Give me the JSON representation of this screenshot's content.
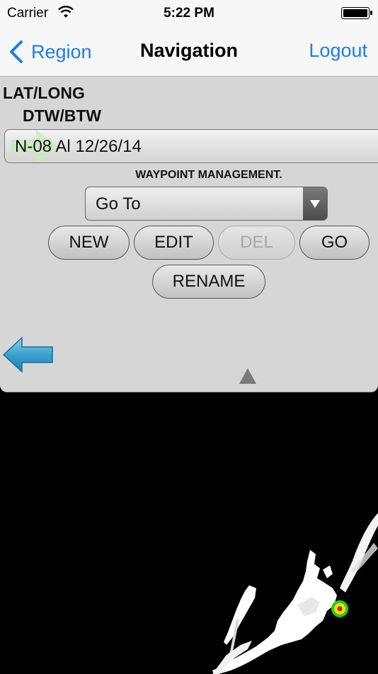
{
  "status_bar": {
    "carrier": "Carrier",
    "time": "5:22 PM",
    "icons": [
      "wifi-icon",
      "battery-icon"
    ]
  },
  "nav_bar": {
    "back_label": "Region",
    "title": "Navigation",
    "right_label": "Logout",
    "accent_color": "#1a7df5"
  },
  "panel": {
    "lat_long": "LAT/LONG",
    "dtw_btw": "DTW/BTW",
    "waypoint_name": "N-08 Al 12/26/14",
    "management_label": "WAYPOINT MANAGEMENT.",
    "action_select": {
      "selected": "Go To"
    },
    "buttons": {
      "new": "NEW",
      "edit": "EDIT",
      "del": "DEL",
      "go": "GO",
      "rename": "RENAME"
    },
    "del_enabled": false,
    "icons": [
      "arrow-left-icon",
      "triangle-up-icon"
    ]
  },
  "map": {
    "terrain_color": "#ffffff",
    "background_color": "#000000",
    "marker_colors": [
      "#22cc22",
      "#f2e200",
      "#d01818"
    ]
  }
}
